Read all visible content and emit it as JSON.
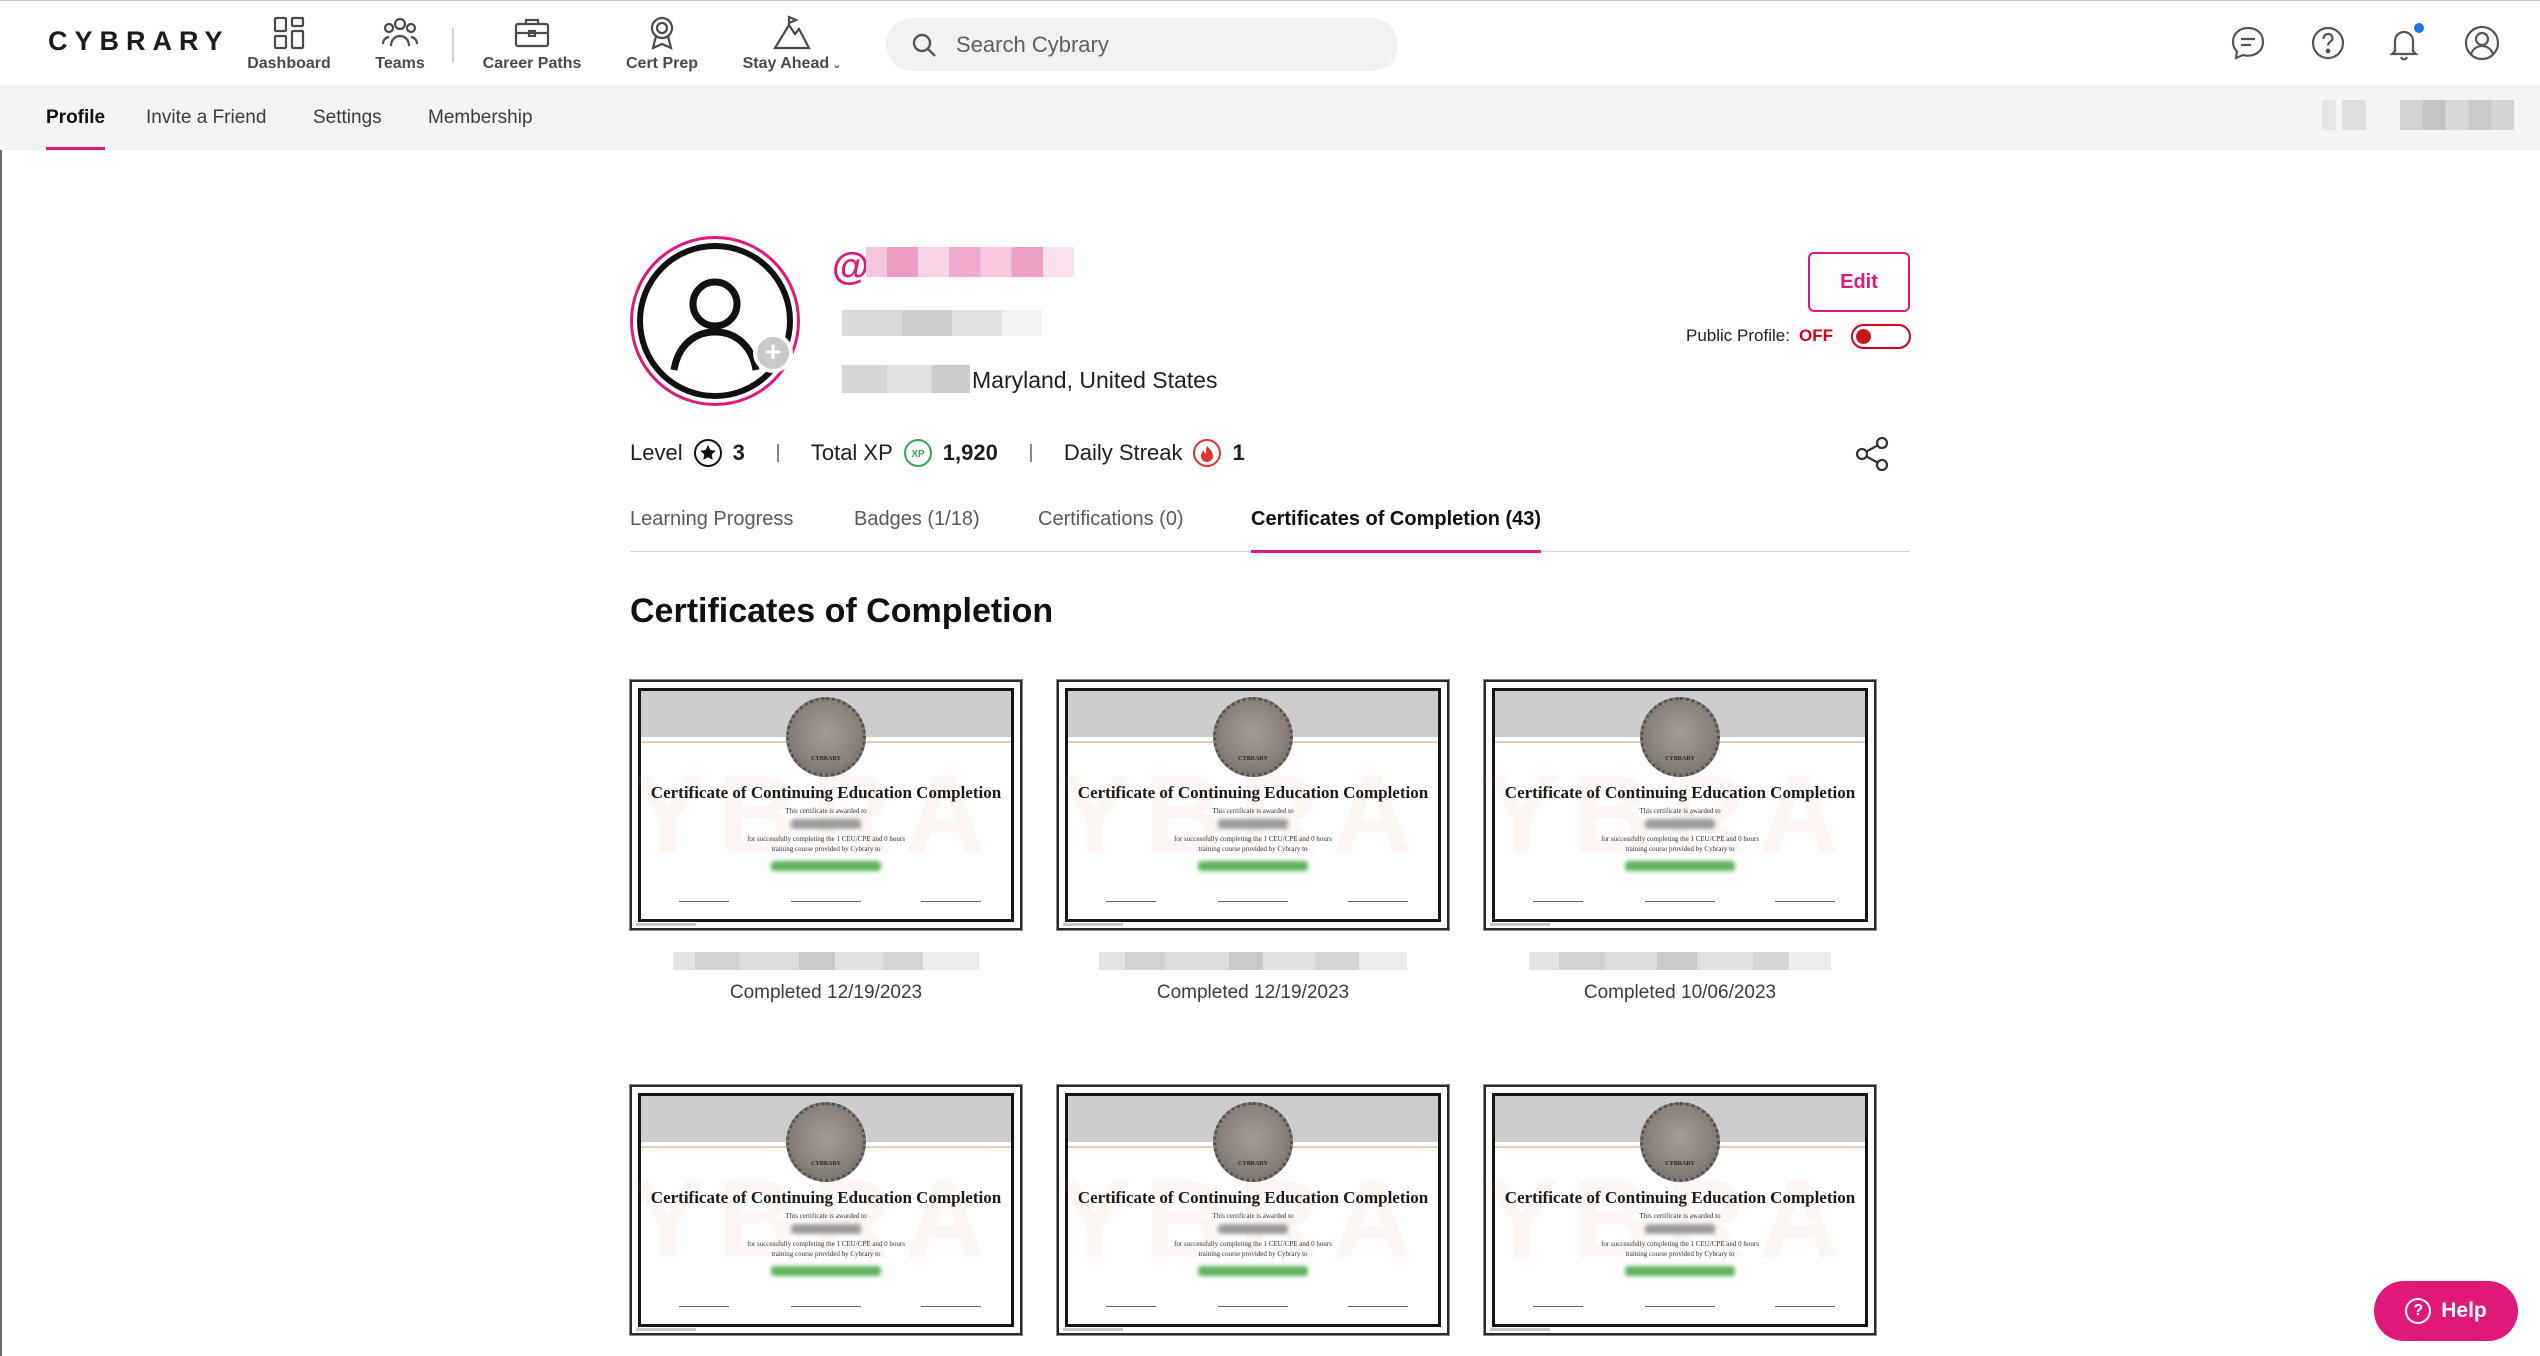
{
  "app": {
    "logo": "CYBRARY"
  },
  "topnav": {
    "items": [
      {
        "label": "Dashboard",
        "icon": "dashboard-icon"
      },
      {
        "label": "Teams",
        "icon": "teams-icon"
      },
      {
        "label": "Career Paths",
        "icon": "briefcase-icon"
      },
      {
        "label": "Cert Prep",
        "icon": "certificate-icon"
      },
      {
        "label": "Stay Ahead",
        "icon": "mountain-icon",
        "has_dropdown": true
      }
    ],
    "search_placeholder": "Search Cybrary",
    "icons": [
      "chat-icon",
      "help-circle-icon",
      "bell-icon",
      "account-icon"
    ],
    "notification_dot_color": "#1e73e8"
  },
  "subnav": {
    "tabs": [
      "Profile",
      "Invite a Friend",
      "Settings",
      "Membership"
    ],
    "active": "Profile"
  },
  "profile": {
    "at_sign": "@",
    "location": "Maryland, United States",
    "edit_label": "Edit",
    "public_profile_label": "Public Profile:",
    "public_profile_state": "OFF"
  },
  "stats": {
    "level_label": "Level",
    "level_value": "3",
    "xp_label": "Total XP",
    "xp_badge": "XP",
    "xp_value": "1,920",
    "streak_label": "Daily Streak",
    "streak_value": "1"
  },
  "tabs": [
    "Learning Progress",
    "Badges (1/18)",
    "Certifications (0)",
    "Certificates of Completion (43)"
  ],
  "active_tab": "Certificates of Completion (43)",
  "section_title": "Certificates of Completion",
  "certificate": {
    "title": "Certificate of Continuing Education Completion",
    "line1": "This certificate is awarded to",
    "line2": "for successfully completing the 1 CEU/CPE and 0 hours",
    "line3": "training course provided by Cybrary to",
    "seal_text": "CYBRARY"
  },
  "cards": [
    {
      "completed": "Completed 12/19/2023"
    },
    {
      "completed": "Completed 12/19/2023"
    },
    {
      "completed": "Completed 10/06/2023"
    },
    {
      "completed": ""
    },
    {
      "completed": ""
    },
    {
      "completed": ""
    }
  ],
  "help_label": "Help",
  "colors": {
    "accent": "#e0187a",
    "off_red": "#d0021b",
    "xp_green": "#3aa35a",
    "streak_red": "#e0342c"
  }
}
